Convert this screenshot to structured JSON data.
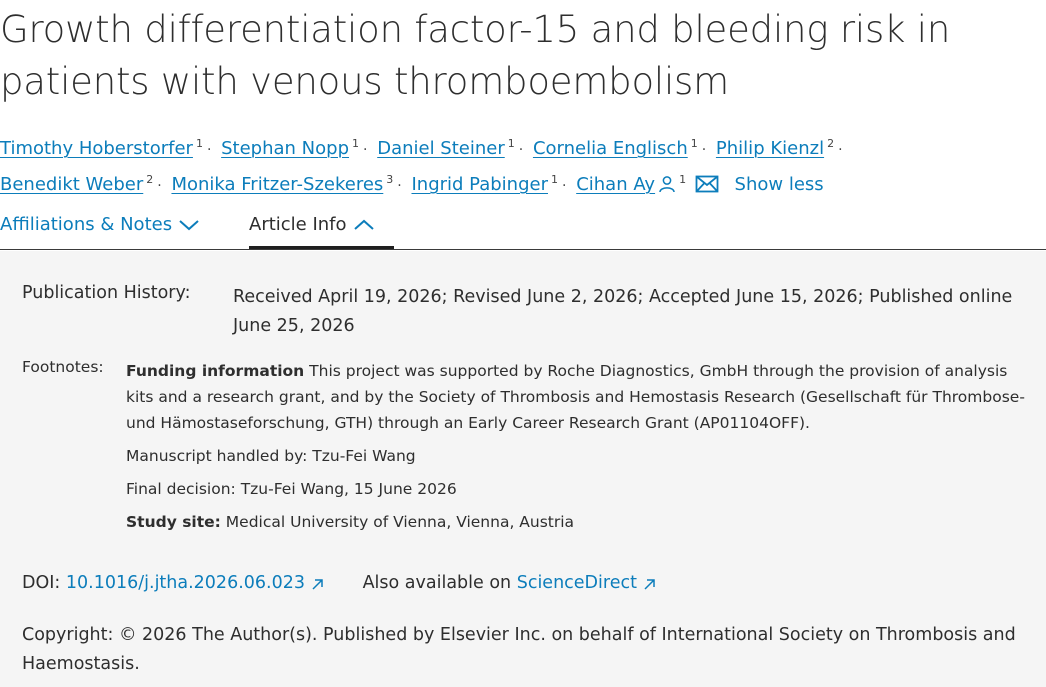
{
  "title": {
    "line1": "Growth differentiation factor-15 and bleeding risk in",
    "line2": "patients with venous thromboembolism"
  },
  "authors": [
    {
      "name": "Timothy Hoberstorfer",
      "aff": "1"
    },
    {
      "name": "Stephan Nopp",
      "aff": "1"
    },
    {
      "name": "Daniel Steiner",
      "aff": "1"
    },
    {
      "name": "Cornelia Englisch",
      "aff": "1"
    },
    {
      "name": "Philip Kienzl",
      "aff": "2"
    },
    {
      "name": "Benedikt Weber",
      "aff": "2"
    },
    {
      "name": "Monika Fritzer-Szekeres",
      "aff": "3"
    },
    {
      "name": "Ingrid Pabinger",
      "aff": "1"
    },
    {
      "name": "Cihan Ay",
      "aff": "1"
    }
  ],
  "author_separator": "·",
  "show_less_label": "Show less",
  "tabs": {
    "affiliations_label": "Affiliations & Notes",
    "article_info_label": "Article Info"
  },
  "publication_history": {
    "label": "Publication History:",
    "value": "Received April 19, 2026; Revised June 2, 2026; Accepted June 15, 2026; Published online June 25, 2026"
  },
  "footnotes": {
    "label": "Footnotes:",
    "funding_heading": "Funding information",
    "funding_text": " This project was supported by Roche Diagnostics, GmbH through the provision of analysis kits and a research grant, and by the Society of Thrombosis and Hemostasis Research (Gesellschaft für Thrombose-und Hämostaseforschung, GTH) through an Early Career Research Grant (AP01104OFF).",
    "handled_by": "Manuscript handled by: Tzu-Fei Wang",
    "final_decision": "Final decision: Tzu-Fei Wang, 15 June 2026",
    "study_site_heading": "Study site:",
    "study_site_text": " Medical University of Vienna, Vienna, Austria"
  },
  "doi": {
    "label": "DOI: ",
    "value": "10.1016/j.jtha.2026.06.023",
    "also_label": "Also available on ",
    "also_link": "ScienceDirect"
  },
  "copyright": "Copyright: © 2026 The Author(s). Published by Elsevier Inc. on behalf of International Society on Thrombosis and Haemostasis.",
  "colors": {
    "link": "#0c7dbb",
    "text": "#2e2e2e",
    "panel_bg": "#f5f5f5"
  },
  "icons": {
    "corresponding_author": "person-icon",
    "email": "mail-icon",
    "tab_collapsed": "chevron-down-icon",
    "tab_expanded": "chevron-up-icon",
    "external": "external-link-icon"
  }
}
